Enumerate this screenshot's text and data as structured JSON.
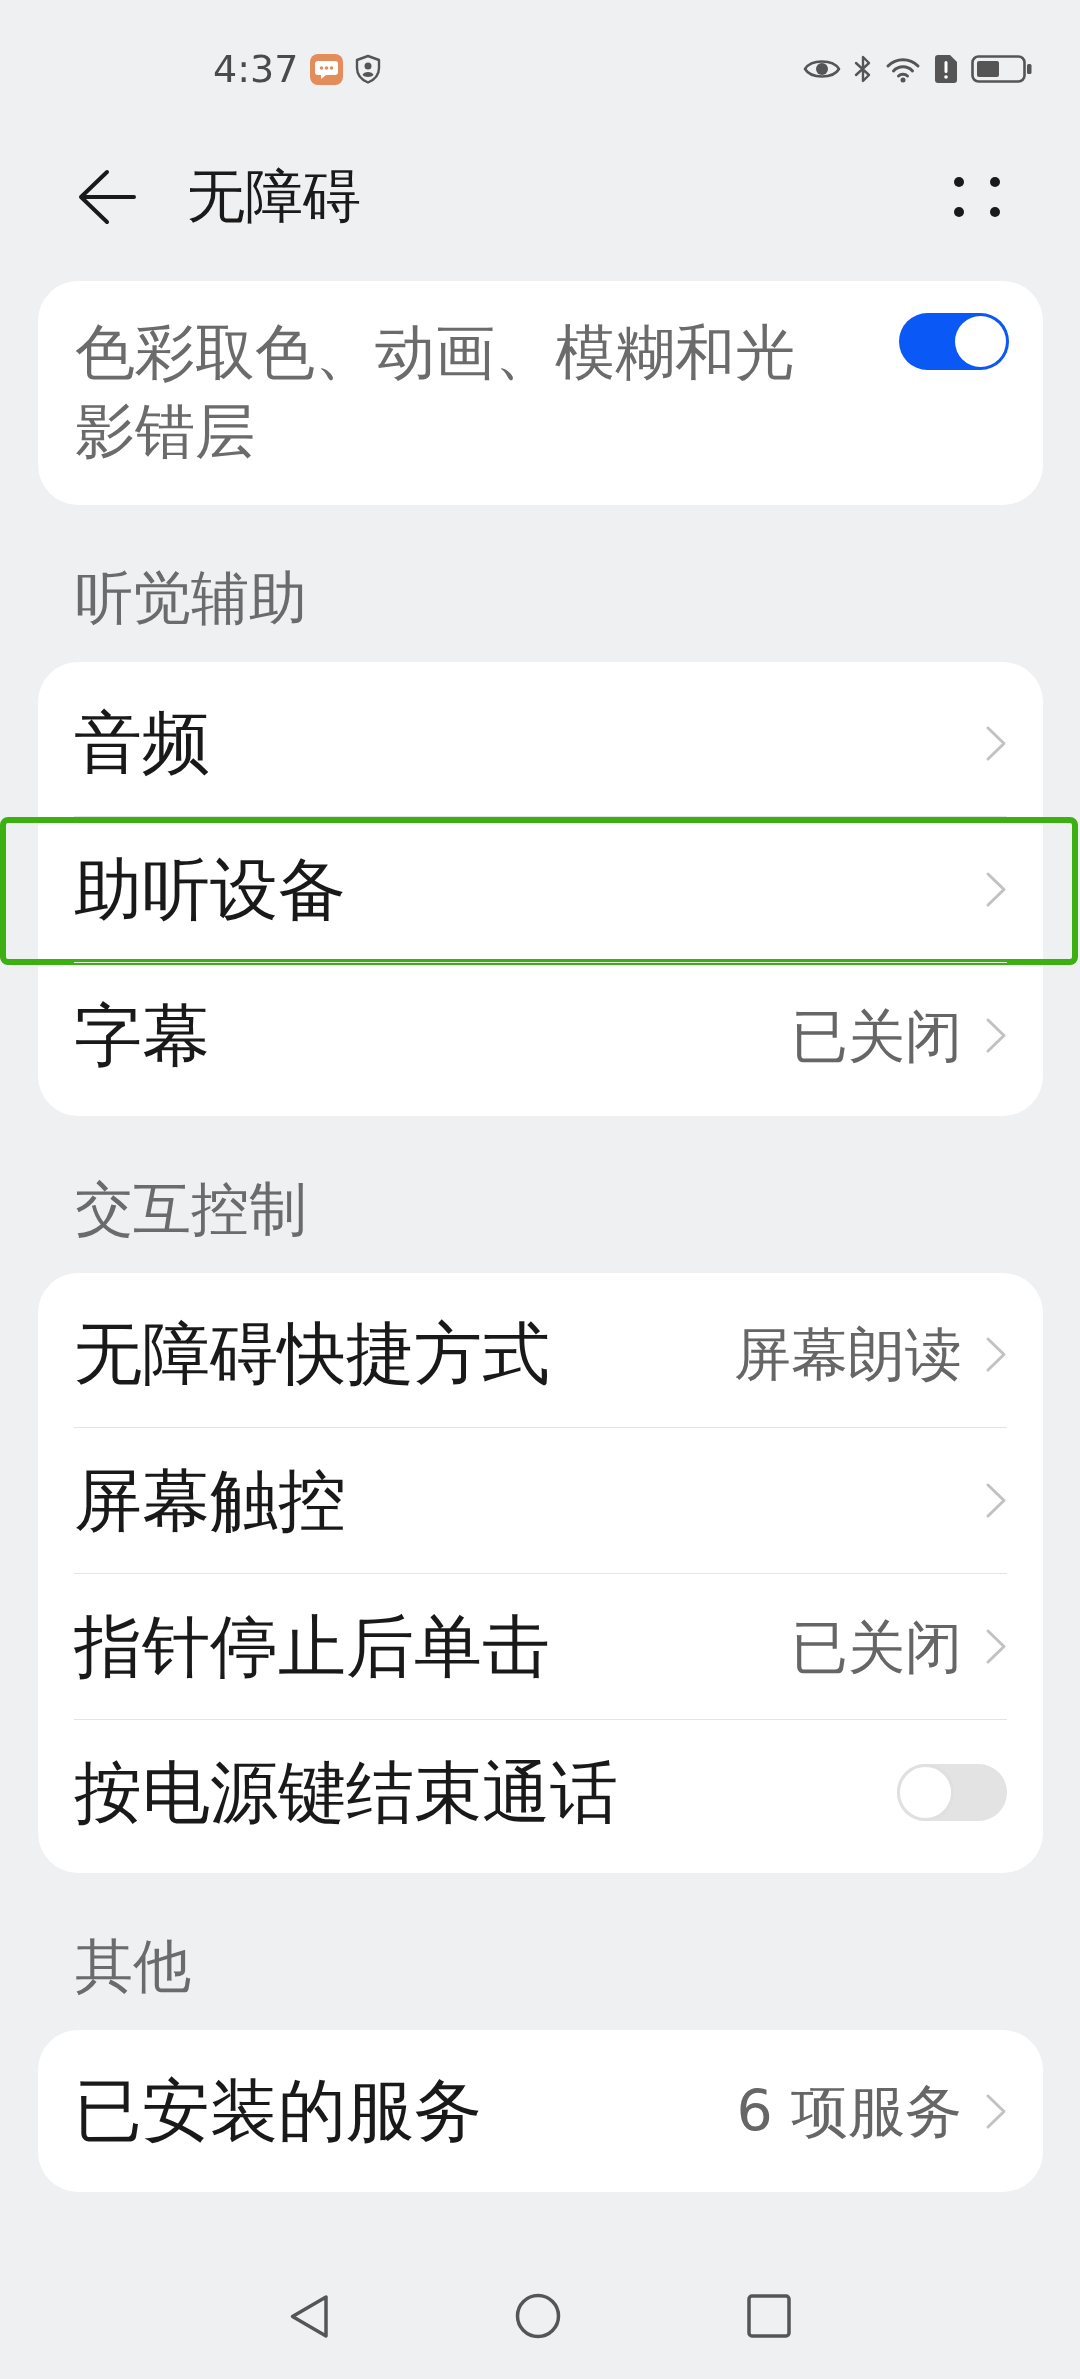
{
  "status_bar": {
    "time": "4:37"
  },
  "app_bar": {
    "title": "无障碍"
  },
  "sections": [
    {
      "items": [
        {
          "kind": "toggle",
          "subtitle": "色彩取色、动画、模糊和光影错层",
          "on": true,
          "highlighted": false
        }
      ]
    },
    {
      "header": "听觉辅助",
      "items": [
        {
          "kind": "link",
          "title": "音频",
          "highlighted": false
        },
        {
          "kind": "link",
          "title": "助听设备",
          "highlighted": true
        },
        {
          "kind": "link",
          "title": "字幕",
          "value": "已关闭",
          "highlighted": false
        }
      ]
    },
    {
      "header": "交互控制",
      "items": [
        {
          "kind": "link",
          "title": "无障碍快捷方式",
          "value": "屏幕朗读",
          "highlighted": false
        },
        {
          "kind": "link",
          "title": "屏幕触控",
          "highlighted": false
        },
        {
          "kind": "link",
          "title": "指针停止后单击",
          "value": "已关闭",
          "highlighted": false
        },
        {
          "kind": "toggle",
          "title": "按电源键结束通话",
          "on": false,
          "highlighted": false
        }
      ]
    },
    {
      "header": "其他",
      "items": [
        {
          "kind": "link",
          "title": "已安装的服务",
          "value": "6 项服务",
          "highlighted": false
        }
      ]
    }
  ]
}
